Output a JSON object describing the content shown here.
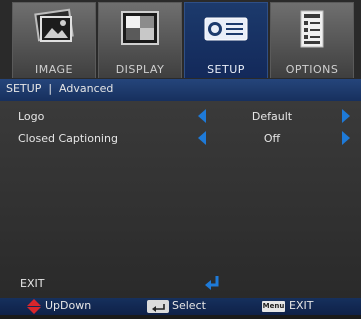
{
  "tabs": [
    {
      "label": "IMAGE",
      "icon": "image-icon",
      "active": false
    },
    {
      "label": "DISPLAY",
      "icon": "display-icon",
      "active": false
    },
    {
      "label": "SETUP",
      "icon": "projector-icon",
      "active": true
    },
    {
      "label": "OPTIONS",
      "icon": "options-icon",
      "active": false
    }
  ],
  "breadcrumb": "SETUP  |  Advanced",
  "settings": [
    {
      "label": "Logo",
      "value": "Default"
    },
    {
      "label": "Closed Captioning",
      "value": "Off"
    }
  ],
  "exit_label": "EXIT",
  "footer": {
    "updown_label": "UpDown",
    "select_label": "Select",
    "menu_key": "Menu",
    "exit_label": "EXIT"
  },
  "colors": {
    "accent_blue": "#1e7ad8",
    "active_tab": "#1c3a6c",
    "footer_bg": "#16305d",
    "updown_red": "#d9262c"
  }
}
